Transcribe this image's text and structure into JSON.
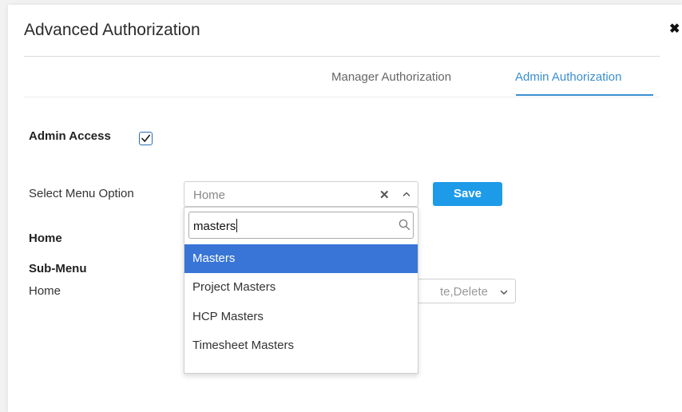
{
  "modal": {
    "title": "Advanced Authorization",
    "close_symbol": "✖",
    "close_icon": "close-icon"
  },
  "tabs": [
    {
      "label": "Manager Authorization",
      "active": false
    },
    {
      "label": "Admin Authorization",
      "active": true
    }
  ],
  "admin_access": {
    "label": "Admin Access",
    "checked": true
  },
  "menu_select": {
    "label": "Select Menu Option",
    "value": "Home",
    "clear_symbol": "✕",
    "caret_icon": "chevron-up-icon",
    "search_value": "masters",
    "search_icon": "search-icon",
    "options": [
      {
        "label": "Masters",
        "highlighted": true
      },
      {
        "label": "Project Masters",
        "highlighted": false
      },
      {
        "label": "HCP Masters",
        "highlighted": false
      },
      {
        "label": "Timesheet Masters",
        "highlighted": false
      }
    ]
  },
  "save_button": {
    "label": "Save"
  },
  "section": {
    "heading": "Home",
    "submenu_heading": "Sub-Menu",
    "submenu_item": "Home",
    "permission_value": "te,Delete",
    "permission_caret_icon": "chevron-down-icon"
  },
  "colors": {
    "accent": "#3a8fd0",
    "save_button": "#1e9be8",
    "option_highlight": "#3875d7",
    "checkbox_border": "#2a6db5"
  }
}
